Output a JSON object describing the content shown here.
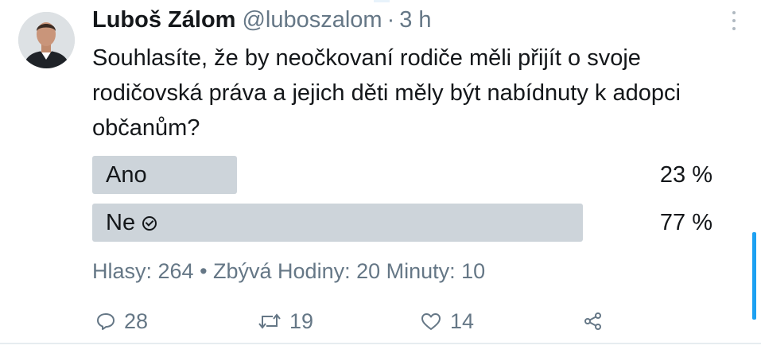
{
  "tweet": {
    "author_name": "Luboš Zálom",
    "author_handle": "@luboszalom",
    "separator": "·",
    "time_ago": "3 h",
    "text": "Souhlasíte, že by neočkovaní rodiče měli přijít o svoje rodičovská práva a jejich děti měly být nabídnuty k adopci občanům?"
  },
  "poll": {
    "options": [
      {
        "label": "Ano",
        "percent_label": "23 %",
        "percent": 23,
        "winner": false
      },
      {
        "label": "Ne",
        "percent_label": "77 %",
        "percent": 77,
        "winner": true
      }
    ],
    "meta": "Hlasy: 264 • Zbývá Hodiny: 20 Minuty: 10"
  },
  "actions": {
    "reply_count": "28",
    "retweet_count": "19",
    "like_count": "14"
  },
  "icons": {
    "reply": "reply-icon",
    "retweet": "retweet-icon",
    "like": "heart-icon",
    "share": "share-icon",
    "more": "more-vertical-icon",
    "winner": "check-circle-icon"
  },
  "colors": {
    "text": "#14171a",
    "secondary": "#657786",
    "poll_bar": "#cdd4da",
    "accent": "#1da1f2"
  }
}
